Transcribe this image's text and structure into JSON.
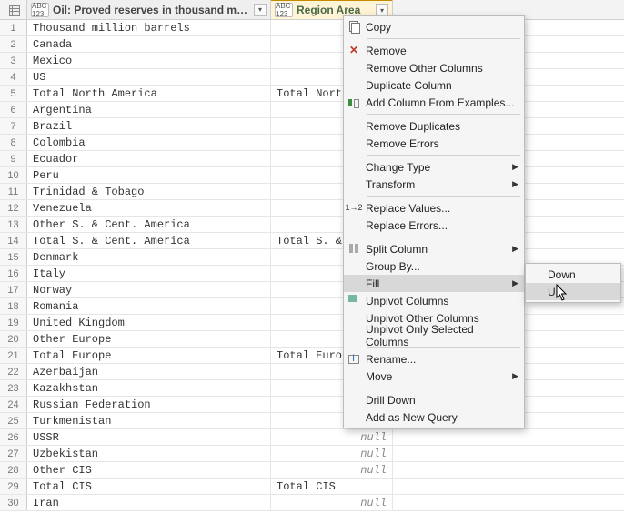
{
  "columns": {
    "col1": {
      "type_icon": "ABC 123",
      "label": "Oil: Proved reserves in thousand million barrels"
    },
    "col2": {
      "type_icon": "ABC 123",
      "label": "Region Area"
    }
  },
  "rows": [
    {
      "n": 1,
      "c1": "Thousand million barrels",
      "c2": ""
    },
    {
      "n": 2,
      "c1": "Canada",
      "c2": ""
    },
    {
      "n": 3,
      "c1": "Mexico",
      "c2": ""
    },
    {
      "n": 4,
      "c1": "US",
      "c2": ""
    },
    {
      "n": 5,
      "c1": "Total North America",
      "c2": "Total North"
    },
    {
      "n": 6,
      "c1": "Argentina",
      "c2": ""
    },
    {
      "n": 7,
      "c1": "Brazil",
      "c2": ""
    },
    {
      "n": 8,
      "c1": "Colombia",
      "c2": ""
    },
    {
      "n": 9,
      "c1": "Ecuador",
      "c2": ""
    },
    {
      "n": 10,
      "c1": "Peru",
      "c2": ""
    },
    {
      "n": 11,
      "c1": "Trinidad & Tobago",
      "c2": ""
    },
    {
      "n": 12,
      "c1": "Venezuela",
      "c2": ""
    },
    {
      "n": 13,
      "c1": "Other S. & Cent. America",
      "c2": ""
    },
    {
      "n": 14,
      "c1": "Total S. & Cent. America",
      "c2": "Total S. & C"
    },
    {
      "n": 15,
      "c1": "Denmark",
      "c2": ""
    },
    {
      "n": 16,
      "c1": "Italy",
      "c2": ""
    },
    {
      "n": 17,
      "c1": "Norway",
      "c2": ""
    },
    {
      "n": 18,
      "c1": "Romania",
      "c2": ""
    },
    {
      "n": 19,
      "c1": "United Kingdom",
      "c2": ""
    },
    {
      "n": 20,
      "c1": "Other Europe",
      "c2": ""
    },
    {
      "n": 21,
      "c1": "Total Europe",
      "c2": "Total Europe"
    },
    {
      "n": 22,
      "c1": "Azerbaijan",
      "c2": ""
    },
    {
      "n": 23,
      "c1": "Kazakhstan",
      "c2": ""
    },
    {
      "n": 24,
      "c1": "Russian Federation",
      "c2": ""
    },
    {
      "n": 25,
      "c1": "Turkmenistan",
      "c2": "null"
    },
    {
      "n": 26,
      "c1": "USSR",
      "c2": "null"
    },
    {
      "n": 27,
      "c1": "Uzbekistan",
      "c2": "null"
    },
    {
      "n": 28,
      "c1": "Other CIS",
      "c2": "null"
    },
    {
      "n": 29,
      "c1": "Total CIS",
      "c2": "Total CIS"
    },
    {
      "n": 30,
      "c1": "Iran",
      "c2": "null"
    }
  ],
  "context_menu": {
    "copy": "Copy",
    "remove": "Remove",
    "remove_other": "Remove Other Columns",
    "duplicate": "Duplicate Column",
    "add_examples": "Add Column From Examples...",
    "remove_dup": "Remove Duplicates",
    "remove_err": "Remove Errors",
    "change_type": "Change Type",
    "transform": "Transform",
    "replace_vals": "Replace Values...",
    "replace_errs": "Replace Errors...",
    "split": "Split Column",
    "group_by": "Group By...",
    "fill": "Fill",
    "unpivot": "Unpivot Columns",
    "unpivot_other": "Unpivot Other Columns",
    "unpivot_sel": "Unpivot Only Selected Columns",
    "rename": "Rename...",
    "move": "Move",
    "drill": "Drill Down",
    "add_query": "Add as New Query"
  },
  "submenu_fill": {
    "down": "Down",
    "up": "Up"
  }
}
